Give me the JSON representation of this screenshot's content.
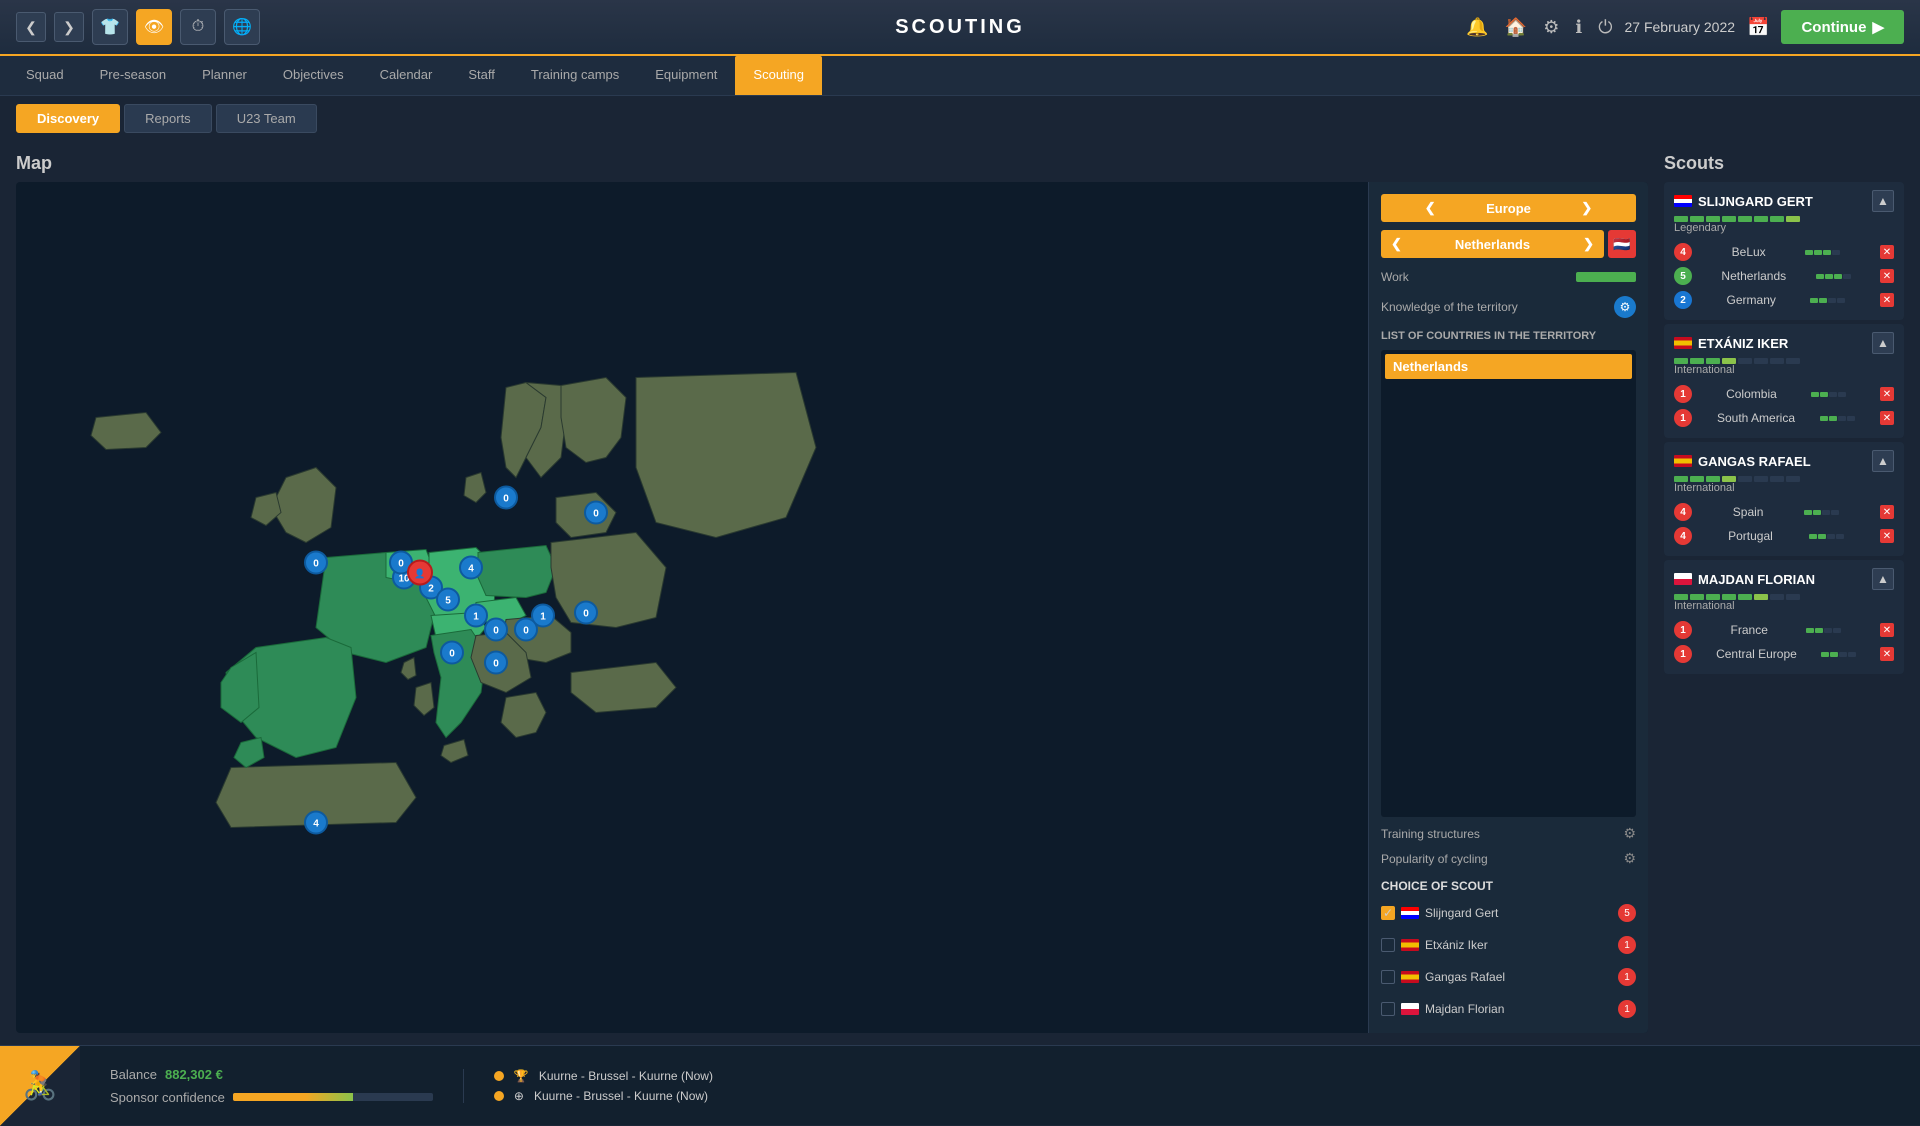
{
  "topbar": {
    "title": "SCOUTING",
    "date": "27 February 2022",
    "continue_label": "Continue"
  },
  "navtabs": {
    "items": [
      "Squad",
      "Pre-season",
      "Planner",
      "Objectives",
      "Calendar",
      "Staff",
      "Training camps",
      "Equipment",
      "Scouting"
    ]
  },
  "subtabs": {
    "items": [
      "Discovery",
      "Reports",
      "U23 Team"
    ]
  },
  "map": {
    "label": "Map",
    "region": "Europe",
    "country": "Netherlands",
    "work_label": "Work",
    "territory_label": "Knowledge of the territory",
    "countries_title": "LIST OF COUNTRIES IN THE TERRITORY",
    "selected_country": "Netherlands",
    "training_structures": "Training structures",
    "popularity_label": "Popularity of cycling",
    "choice_of_scout": "CHOICE OF SCOUT",
    "scouts_choices": [
      {
        "name": "Slijngard Gert",
        "flag": "nl",
        "count": 5,
        "checked": true
      },
      {
        "name": "Etxániz Iker",
        "flag": "es",
        "count": 1,
        "checked": false
      },
      {
        "name": "Gangas Rafael",
        "flag": "es",
        "count": 1,
        "checked": false
      },
      {
        "name": "Majdan Florian",
        "flag": "pl",
        "count": 1,
        "checked": false
      }
    ]
  },
  "scouts": {
    "title": "Scouts",
    "list": [
      {
        "name": "SLIJNGARD GERT",
        "flag": "nl",
        "level": "Legendary",
        "rating_filled": 7,
        "rating_total": 8,
        "countries": [
          {
            "name": "BeLux",
            "num": 4,
            "num_color": "nb-red",
            "mini_filled": 3,
            "mini_total": 4
          },
          {
            "name": "Netherlands",
            "num": 5,
            "num_color": "nb-green",
            "mini_filled": 3,
            "mini_total": 4
          },
          {
            "name": "Germany",
            "num": 2,
            "num_color": "nb-blue",
            "mini_filled": 2,
            "mini_total": 4
          }
        ]
      },
      {
        "name": "ETXÁNIZ IKER",
        "flag": "es",
        "level": "International",
        "rating_filled": 5,
        "rating_total": 8,
        "countries": [
          {
            "name": "Colombia",
            "num": 1,
            "num_color": "nb-red",
            "mini_filled": 2,
            "mini_total": 4
          },
          {
            "name": "South America",
            "num": 1,
            "num_color": "nb-red",
            "mini_filled": 2,
            "mini_total": 4
          }
        ]
      },
      {
        "name": "GANGAS RAFAEL",
        "flag": "es",
        "level": "International",
        "rating_filled": 5,
        "rating_total": 8,
        "countries": [
          {
            "name": "Spain",
            "num": 4,
            "num_color": "nb-red",
            "mini_filled": 2,
            "mini_total": 4
          },
          {
            "name": "Portugal",
            "num": 4,
            "num_color": "nb-red",
            "mini_filled": 2,
            "mini_total": 4
          }
        ]
      },
      {
        "name": "MAJDAN FLORIAN",
        "flag": "pl",
        "level": "International",
        "rating_filled": 6,
        "rating_total": 8,
        "countries": [
          {
            "name": "France",
            "num": 1,
            "num_color": "nb-red",
            "mini_filled": 2,
            "mini_total": 4
          },
          {
            "name": "Central Europe",
            "num": 1,
            "num_color": "nb-red",
            "mini_filled": 2,
            "mini_total": 4
          }
        ]
      }
    ]
  },
  "bottombar": {
    "balance_label": "Balance",
    "balance_value": "882,302 €",
    "sponsor_label": "Sponsor confidence",
    "events": [
      {
        "icon": "trophy",
        "text": "Kuurne - Brussel - Kuurne (Now)"
      },
      {
        "icon": "hud",
        "text": "Kuurne - Brussel - Kuurne (Now)"
      }
    ]
  },
  "icons": {
    "bell": "🔔",
    "home": "🏠",
    "gear": "⚙",
    "info": "ℹ",
    "power": "⏻",
    "chevron_left": "❮",
    "chevron_right": "❯",
    "chevron_up": "▲",
    "chevron_down": "▼",
    "calendar": "📅",
    "continue_arrow": "▶",
    "flag_nl": "🇳🇱",
    "flag_es": "🇪🇸",
    "flag_pl": "🇵🇱",
    "flag_be": "🇧🇪",
    "remove": "✕",
    "trophy": "🏆",
    "hud": "⊕"
  }
}
